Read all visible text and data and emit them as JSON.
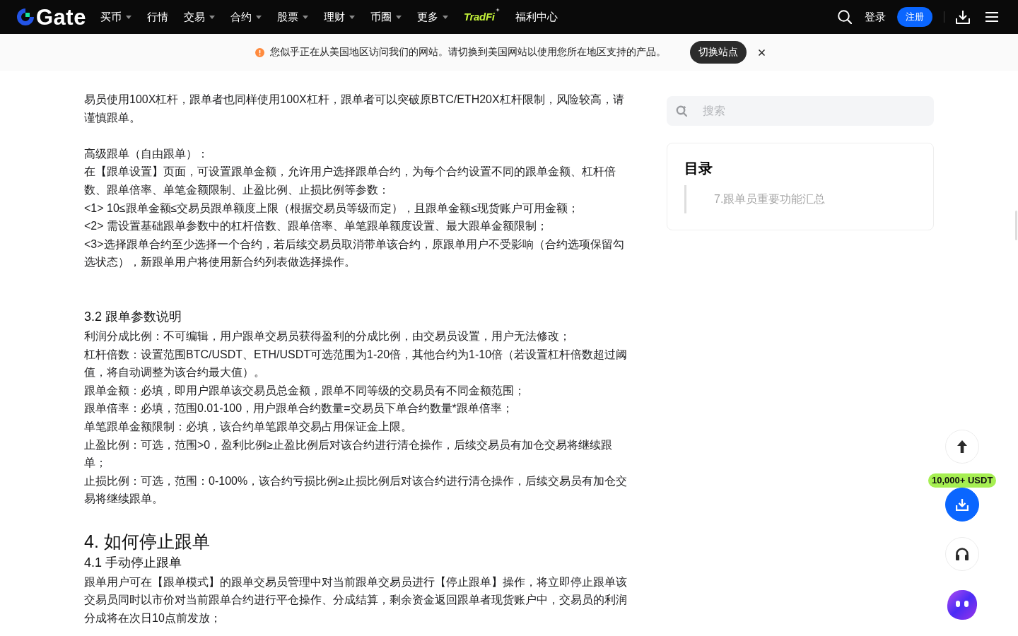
{
  "header": {
    "logo": "Gate",
    "nav": [
      {
        "kind": "link",
        "label": "买币",
        "dropdown": true
      },
      {
        "kind": "link",
        "label": "行情",
        "dropdown": false
      },
      {
        "kind": "link",
        "label": "交易",
        "dropdown": true
      },
      {
        "kind": "link",
        "label": "合约",
        "dropdown": true
      },
      {
        "kind": "link",
        "label": "股票",
        "dropdown": true
      },
      {
        "kind": "link",
        "label": "理财",
        "dropdown": true
      },
      {
        "kind": "link",
        "label": "币圈",
        "dropdown": true
      },
      {
        "kind": "link",
        "label": "更多",
        "dropdown": true
      },
      {
        "kind": "brand",
        "label": "TradFi",
        "dropdown": false
      },
      {
        "kind": "link",
        "label": "福利中心",
        "dropdown": false
      }
    ],
    "login": "登录",
    "register": "注册"
  },
  "notice": {
    "text": "您似乎正在从美国地区访问我们的网站。请切换到美国网站以使用您所在地区支持的产品。",
    "button": "切换站点"
  },
  "article": {
    "blocks": [
      {
        "kind": "text",
        "lines": [
          "易员使用100X杠杆，跟单者也同样使用100X杠杆，跟单者可以突破原BTC/ETH20X杠杆限制，风险较高，请谨慎跟单。"
        ]
      },
      {
        "kind": "text",
        "lines": [
          "高级跟单（自由跟单）：",
          "在【跟单设置】页面，可设置跟单金额，允许用户选择跟单合约，为每个合约设置不同的跟单金额、杠杆倍数、跟单倍率、单笔金额限制、止盈比例、止损比例等参数：",
          "<1> 10≤跟单金额≤交易员跟单额度上限（根据交易员等级而定），且跟单金额≤现货账户可用金额；",
          "<2> 需设置基础跟单参数中的杠杆倍数、跟单倍率、单笔跟单额度设置、最大跟单金额限制；",
          "<3>选择跟单合约至少选择一个合约，若后续交易员取消带单该合约，原跟单用户不受影响（合约选项保留勾选状态），新跟单用户将使用新合约列表做选择操作。"
        ]
      },
      {
        "kind": "subheading",
        "text": "3.2 跟单参数说明"
      },
      {
        "kind": "text",
        "lines": [
          "利润分成比例：不可编辑，用户跟单交易员获得盈利的分成比例，由交易员设置，用户无法修改；",
          "杠杆倍数：设置范围BTC/USDT、ETH/USDT可选范围为1-20倍，其他合约为1-10倍（若设置杠杆倍数超过阈值，将自动调整为该合约最大值）。",
          "跟单金额：必填，即用户跟单该交易员总金额，跟单不同等级的交易员有不同金额范围；",
          "跟单倍率：必填，范围0.01-100，用户跟单合约数量=交易员下单合约数量*跟单倍率；",
          "单笔跟单金额限制：必填，该合约单笔跟单交易占用保证金上限。",
          "止盈比例：可选，范围>0，盈利比例≥止盈比例后对该合约进行清仓操作，后续交易员有加仓交易将继续跟单；",
          "止损比例：可选，范围：0-100%，该合约亏损比例≥止损比例后对该合约进行清仓操作，后续交易员有加仓交易将继续跟单。"
        ]
      },
      {
        "kind": "heading",
        "text": "4. 如何停止跟单"
      },
      {
        "kind": "subheading",
        "text": "4.1 手动停止跟单"
      },
      {
        "kind": "text",
        "lines": [
          "跟单用户可在【跟单模式】的跟单交易员管理中对当前跟单交易员进行【停止跟单】操作，将立即停止跟单该交易员同时以市价对当前跟单合约进行平仓操作、分成结算，剩余资金返回跟单者现货账户中，交易员的利润分成将在次日10点前发放；"
        ]
      }
    ]
  },
  "sidebar": {
    "search": {
      "placeholder": "搜索"
    },
    "toc": {
      "title": "目录",
      "items": [
        {
          "label": "7.跟单员重要功能汇总",
          "selected": false
        }
      ]
    }
  },
  "floating": {
    "badge": "10,000+ USDT"
  }
}
